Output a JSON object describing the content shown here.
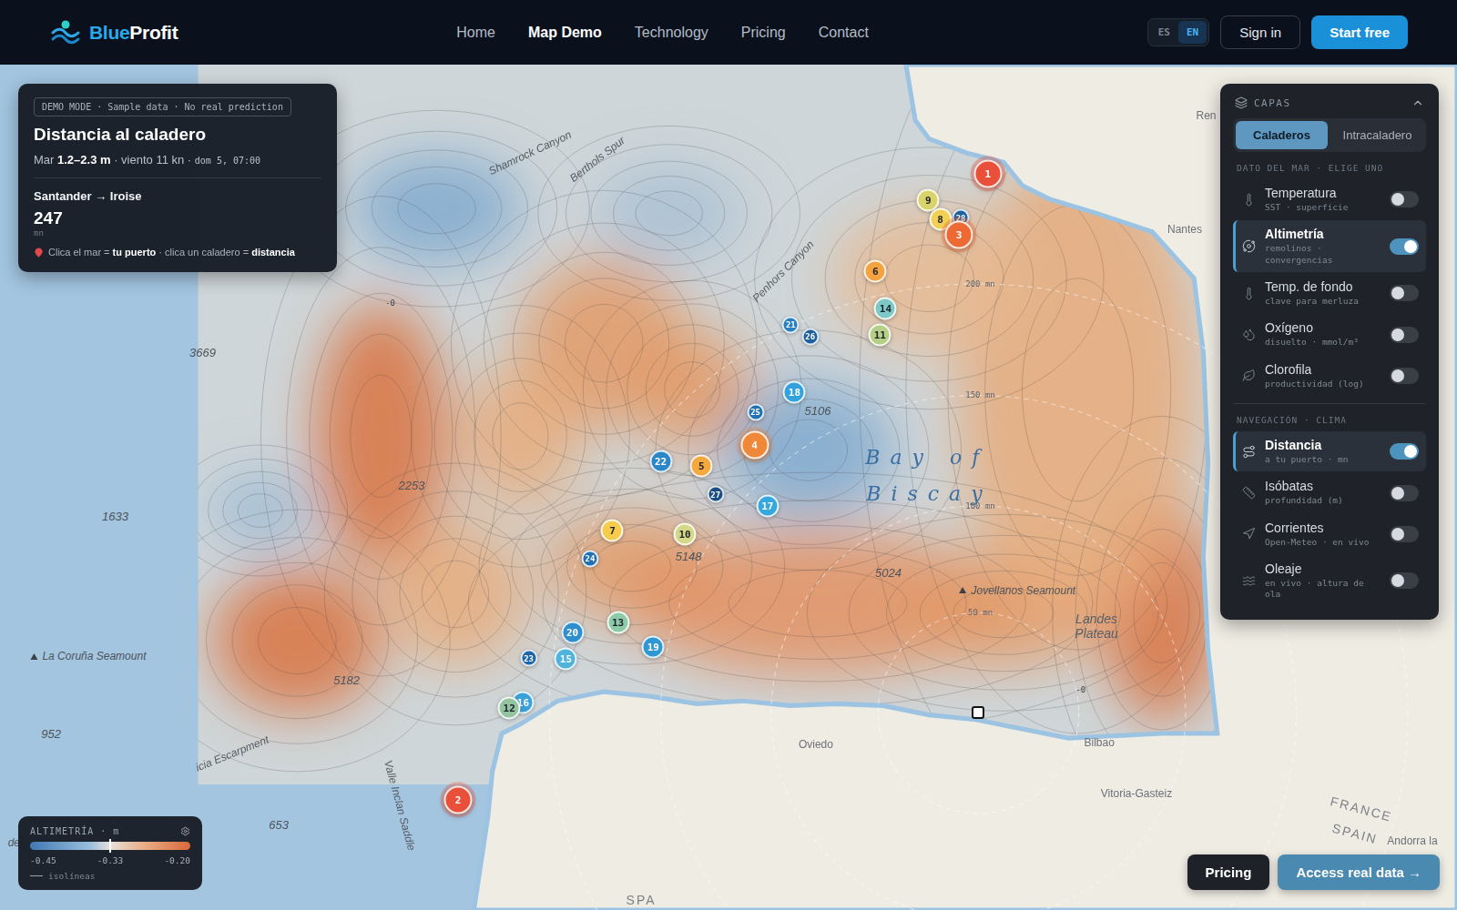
{
  "header": {
    "logo": {
      "first": "Blue",
      "second": "Profit"
    },
    "nav": [
      {
        "label": "Home",
        "selected": false
      },
      {
        "label": "Map Demo",
        "selected": true
      },
      {
        "label": "Technology",
        "selected": false
      },
      {
        "label": "Pricing",
        "selected": false
      },
      {
        "label": "Contact",
        "selected": false
      }
    ],
    "languages": [
      {
        "label": "ES",
        "selected": false
      },
      {
        "label": "EN",
        "selected": true
      }
    ],
    "sign_in": "Sign in",
    "start": "Start free"
  },
  "info_card": {
    "badge": "DEMO MODE · Sample data · No real prediction",
    "title": "Distancia al caladero",
    "conditions": {
      "prefix": "Mar ",
      "sea": "1.2–2.3 m",
      "middle": " · viento 11 kn · ",
      "time": "dom 5, 07:00"
    },
    "route": "Santander → Iroise",
    "value": "247",
    "unit": "mn",
    "hint": [
      {
        "text": "Clica el mar = ",
        "bold": false
      },
      {
        "text": "tu puerto",
        "bold": true
      },
      {
        "text": " · clica un caladero = ",
        "bold": false
      },
      {
        "text": "distancia",
        "bold": true
      }
    ]
  },
  "layers_panel": {
    "title": "CAPAS",
    "expanded": true,
    "tabs": [
      {
        "label": "Caladeros",
        "selected": true
      },
      {
        "label": "Intracaladero",
        "selected": false
      }
    ],
    "sections": [
      {
        "title": "DATO DEL MAR · ELIGE UNO",
        "items": [
          {
            "title": "Temperatura",
            "subtitle": "SST · superficie",
            "on": false
          },
          {
            "title": "Altimetría",
            "subtitle": "remolinos · convergencias",
            "on": true
          },
          {
            "title": "Temp. de fondo",
            "subtitle": "clave para merluza",
            "on": false
          },
          {
            "title": "Oxígeno",
            "subtitle": "disuelto · mmol/m³",
            "on": false
          },
          {
            "title": "Clorofila",
            "subtitle": "productividad (log)",
            "on": false
          }
        ]
      },
      {
        "title": "NAVEGACIÓN · CLIMA",
        "items": [
          {
            "title": "Distancia",
            "subtitle": "a tu puerto · mn",
            "on": true
          },
          {
            "title": "Isóbatas",
            "subtitle": "profundidad (m)",
            "on": false
          },
          {
            "title": "Corrientes",
            "subtitle": "Open-Meteo · en vivo",
            "on": false
          },
          {
            "title": "Oleaje",
            "subtitle": "en vivo · altura de ola",
            "on": false
          }
        ]
      }
    ]
  },
  "legend": {
    "title": "ALTIMETRÍA · m",
    "ticks": [
      "-0.45",
      "-0.33",
      "-0.20"
    ],
    "level": 0.5,
    "line_label": "isolíneas"
  },
  "map": {
    "labels": [
      {
        "text": "Shamrock Canyon",
        "kind": "feature"
      },
      {
        "text": "Berthols Spur",
        "kind": "feature"
      },
      {
        "text": "Penhors Canyon",
        "kind": "feature"
      },
      {
        "text": "Bay of",
        "kind": "sea"
      },
      {
        "text": "Biscay",
        "kind": "sea"
      },
      {
        "text": "5106",
        "kind": "depth"
      },
      {
        "text": "5148",
        "kind": "depth"
      },
      {
        "text": "5024",
        "kind": "depth"
      },
      {
        "text": "2253",
        "kind": "depth"
      },
      {
        "text": "3669",
        "kind": "depth"
      },
      {
        "text": "1633",
        "kind": "depth"
      },
      {
        "text": "5182",
        "kind": "depth"
      },
      {
        "text": "952",
        "kind": "depth"
      },
      {
        "text": "653",
        "kind": "depth"
      },
      {
        "text": "-0",
        "kind": "tiny"
      },
      {
        "text": "-0",
        "kind": "tiny"
      },
      {
        "text": "La Coruña Seamount",
        "kind": "seamount"
      },
      {
        "text": "Jovellanos Seamount",
        "kind": "seamount"
      },
      {
        "text": "Landes Plateau",
        "kind": "plateau"
      },
      {
        "text": "Valle Inclan Saddle",
        "kind": "feature"
      },
      {
        "text": "icia Escarpment",
        "kind": "feature"
      },
      {
        "text": "des",
        "kind": "feature"
      },
      {
        "text": "200 mn",
        "kind": "ring"
      },
      {
        "text": "150 mn",
        "kind": "ring"
      },
      {
        "text": "100 mn",
        "kind": "ring"
      },
      {
        "text": "50 mn",
        "kind": "ring"
      },
      {
        "text": "Nantes",
        "kind": "place"
      },
      {
        "text": "Ren",
        "kind": "place"
      },
      {
        "text": "Oviedo",
        "kind": "place"
      },
      {
        "text": "Bilbao",
        "kind": "place"
      },
      {
        "text": "Vitoria-Gasteiz",
        "kind": "place"
      },
      {
        "text": "FRANCE",
        "kind": "country"
      },
      {
        "text": "SPAIN",
        "kind": "country"
      },
      {
        "text": "Andorra la",
        "kind": "place"
      },
      {
        "text": "SPA",
        "kind": "country"
      }
    ],
    "pins": [
      {
        "number": "1",
        "kind": "large",
        "color": "#e8503a"
      },
      {
        "number": "2",
        "kind": "large",
        "color": "#e8503a"
      },
      {
        "number": "3",
        "kind": "large",
        "color": "#ee6a34"
      },
      {
        "number": "4",
        "kind": "large",
        "color": "#f0883a"
      },
      {
        "number": "5",
        "kind": "medium",
        "color": "#f5a83e"
      },
      {
        "number": "6",
        "kind": "medium",
        "color": "#f4a340"
      },
      {
        "number": "7",
        "kind": "medium",
        "color": "#f6cc4a"
      },
      {
        "number": "8",
        "kind": "medium",
        "color": "#f2cf55"
      },
      {
        "number": "9",
        "kind": "medium",
        "color": "#d9d46a"
      },
      {
        "number": "10",
        "kind": "medium",
        "color": "#d5d888"
      },
      {
        "number": "11",
        "kind": "medium",
        "color": "#b5cf86"
      },
      {
        "number": "12",
        "kind": "medium",
        "color": "#93c3a0"
      },
      {
        "number": "13",
        "kind": "medium",
        "color": "#8ccaa8"
      },
      {
        "number": "14",
        "kind": "medium",
        "color": "#7ec8c6"
      },
      {
        "number": "15",
        "kind": "medium",
        "color": "#4fb3dc"
      },
      {
        "number": "16",
        "kind": "medium",
        "color": "#3aa2d8"
      },
      {
        "number": "17",
        "kind": "medium",
        "color": "#36a8e0"
      },
      {
        "number": "18",
        "kind": "medium",
        "color": "#33a2dc"
      },
      {
        "number": "19",
        "kind": "medium",
        "color": "#2e97d4"
      },
      {
        "number": "20",
        "kind": "medium",
        "color": "#2d8fd0"
      },
      {
        "number": "21",
        "kind": "small",
        "color": "#2a7fc0"
      },
      {
        "number": "22",
        "kind": "medium",
        "color": "#2b87c8"
      },
      {
        "number": "23",
        "kind": "small",
        "color": "#1f66a8"
      },
      {
        "number": "24",
        "kind": "small",
        "color": "#2270b4"
      },
      {
        "number": "25",
        "kind": "small",
        "color": "#2370b2"
      },
      {
        "number": "26",
        "kind": "small",
        "color": "#1e5f9e"
      },
      {
        "number": "27",
        "kind": "small",
        "color": "#1b4f84"
      },
      {
        "number": "28",
        "kind": "small",
        "color": "#1e5f9e"
      }
    ]
  },
  "actions": [
    {
      "label": "Pricing",
      "kind": "secondary"
    },
    {
      "label": "Access real data →",
      "kind": "primary"
    }
  ]
}
